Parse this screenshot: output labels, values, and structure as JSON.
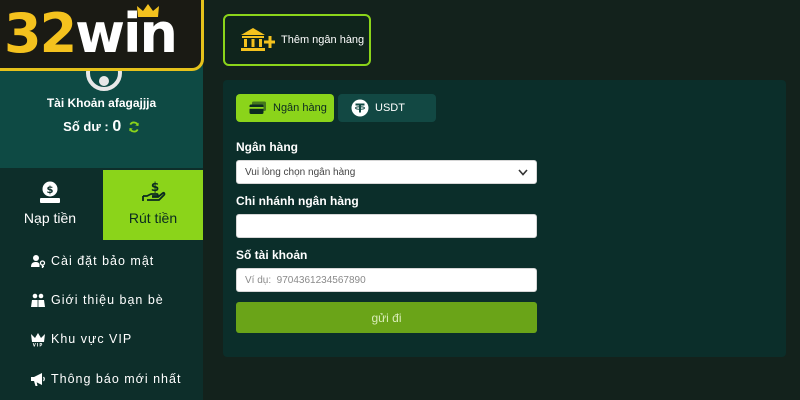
{
  "brand": {
    "logo_number": "32",
    "logo_word": "win"
  },
  "account": {
    "name": "Tài Khoản afagajjja",
    "balance_label": "Số dư :",
    "balance_value": "0"
  },
  "tiles": {
    "deposit_label": "Nạp tiền",
    "withdraw_label": "Rút tiền"
  },
  "menu": [
    {
      "label": "Cài đặt bảo mật",
      "icon": "user-key-icon"
    },
    {
      "label": "Giới thiệu bạn bè",
      "icon": "friends-icon"
    },
    {
      "label": "Khu vực VIP",
      "icon": "vip-crown-icon"
    },
    {
      "label": "Thông báo mới nhất",
      "icon": "megaphone-icon"
    }
  ],
  "add_bank": {
    "label": "Thêm ngân hàng"
  },
  "tabs": {
    "bank_label": "Ngân hàng",
    "usdt_label": "USDT"
  },
  "form": {
    "bank_label": "Ngân hàng",
    "bank_select_value": "Vui lòng chọn ngân hàng",
    "branch_label": "Chi nhánh ngân hàng",
    "branch_value": "",
    "account_label": "Số tài khoản",
    "account_placeholder": "Ví dụ:  9704361234567890",
    "account_value": "",
    "submit_label": "gửi đi"
  },
  "colors": {
    "accent_green": "#8bd41a",
    "logo_gold": "#f4c21e",
    "sidebar_bg": "#0d2e2a",
    "panel_bg": "#0b2e2a",
    "submit_bg": "#6aa418"
  }
}
